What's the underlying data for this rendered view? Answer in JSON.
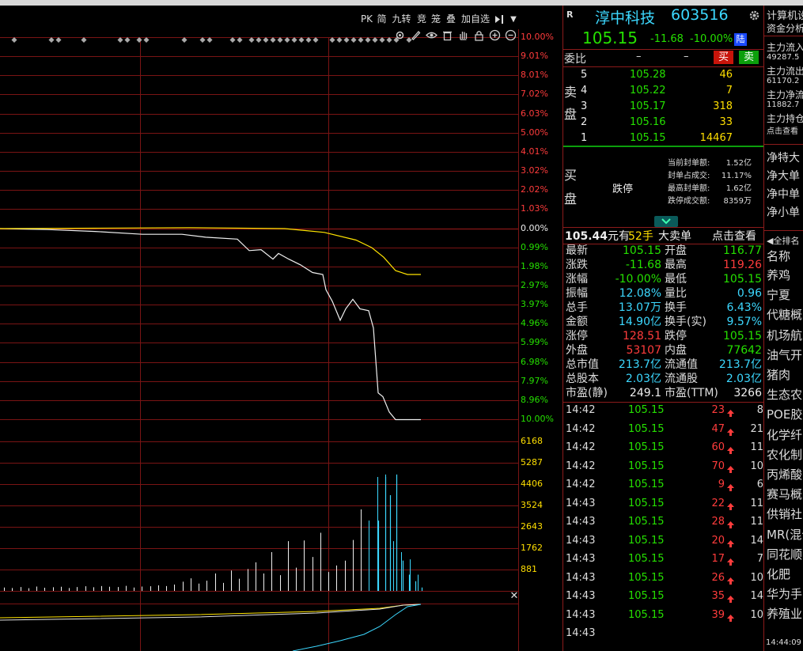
{
  "toolbar": {
    "buttons": [
      "PK",
      "简",
      "九转",
      "竞",
      "笼",
      "叠",
      "加自选"
    ],
    "arrow": "▼"
  },
  "price_axis": {
    "up": [
      "10.00%",
      "9.01%",
      "8.01%",
      "7.02%",
      "6.03%",
      "5.00%",
      "4.01%",
      "3.02%",
      "2.02%",
      "1.03%",
      "0.00%"
    ],
    "down": [
      "0.99%",
      "1.98%",
      "2.97%",
      "3.97%",
      "4.96%",
      "5.99%",
      "6.98%",
      "7.97%",
      "8.96%",
      "10.00%"
    ]
  },
  "volume_axis": [
    "6168",
    "5287",
    "4406",
    "3524",
    "2643",
    "1762",
    "881"
  ],
  "chart_data": {
    "type": "line",
    "price_pct": [
      0,
      -0.1,
      -0.2,
      -0.3,
      -0.4,
      -0.5,
      -0.6,
      -0.7,
      -0.8,
      -0.9,
      -1.0,
      -1.2,
      -1.4,
      -1.3,
      -1.5,
      -1.7,
      -1.9,
      -2.1,
      -2.3,
      -2.5,
      -2.5
    ],
    "avg_pct": [
      0,
      0,
      0,
      0,
      0,
      -0.1,
      -0.2,
      -0.4,
      -0.6,
      -1.0,
      -1.5,
      -2.6,
      -4.0,
      -4.8,
      -3.8,
      -4.4,
      -4.5,
      -6.4,
      -8.6,
      -9.6,
      -10.0,
      -10.0
    ],
    "volume": [
      140,
      120,
      160,
      110,
      180,
      130,
      150,
      170,
      120,
      160,
      190,
      150,
      200,
      170,
      160,
      210,
      140,
      180,
      190,
      230,
      200,
      260,
      380,
      520,
      300,
      420,
      720,
      330,
      840,
      500,
      900,
      1180,
      720,
      1600,
      650,
      2050,
      960,
      2080,
      1400,
      2400,
      780,
      1050,
      1250,
      2100,
      3360,
      2900,
      4700,
      4800,
      2050,
      1600,
      1300,
      670
    ]
  },
  "quote": {
    "logo_letter": "R",
    "name": "淳中科技",
    "code": "603516",
    "price": "105.15",
    "change": "-11.68",
    "change_pct": "-10.00%",
    "tag": "陆",
    "weibi_label": "委比",
    "weibi_val1": "–",
    "weibi_val2": "–",
    "buy_btn": "买",
    "sell_btn": "卖",
    "sell_label": "卖盘",
    "sell_orders": [
      {
        "level": "5",
        "price": "105.28",
        "vol": "46"
      },
      {
        "level": "4",
        "price": "105.22",
        "vol": "7"
      },
      {
        "level": "3",
        "price": "105.17",
        "vol": "318"
      },
      {
        "level": "2",
        "price": "105.16",
        "vol": "33"
      },
      {
        "level": "1",
        "price": "105.15",
        "vol": "14467"
      }
    ],
    "buy_label": "买盘",
    "limit_down": "跌停",
    "seal": [
      {
        "label": "当前封单额:",
        "val": "1.52亿"
      },
      {
        "label": "封单占成交:",
        "val": "11.17%"
      },
      {
        "label": "最高封单额:",
        "val": "1.62亿"
      },
      {
        "label": "跌停成交额:",
        "val": "8359万"
      }
    ],
    "big_order": {
      "price": "105.44",
      "unit": "元有",
      "lots": "52手",
      "label": "大卖单",
      "link": "点击查看"
    },
    "stats": [
      {
        "l1": "最新",
        "v1": "105.15",
        "c1": "green",
        "l2": "开盘",
        "v2": "116.77",
        "c2": "green"
      },
      {
        "l1": "涨跌",
        "v1": "-11.68",
        "c1": "green",
        "l2": "最高",
        "v2": "119.26",
        "c2": "red"
      },
      {
        "l1": "涨幅",
        "v1": "-10.00%",
        "c1": "green",
        "l2": "最低",
        "v2": "105.15",
        "c2": "green"
      },
      {
        "l1": "振幅",
        "v1": "12.08%",
        "c1": "cyan",
        "l2": "量比",
        "v2": "0.96",
        "c2": "cyan"
      },
      {
        "l1": "总手",
        "v1": "13.07万",
        "c1": "cyan",
        "l2": "换手",
        "v2": "6.43%",
        "c2": "cyan"
      },
      {
        "l1": "金额",
        "v1": "14.90亿",
        "c1": "cyan",
        "l2": "换手(实)",
        "v2": "9.57%",
        "c2": "cyan"
      },
      {
        "l1": "涨停",
        "v1": "128.51",
        "c1": "red",
        "l2": "跌停",
        "v2": "105.15",
        "c2": "green"
      },
      {
        "l1": "外盘",
        "v1": "53107",
        "c1": "red",
        "l2": "内盘",
        "v2": "77642",
        "c2": "green"
      },
      {
        "l1": "总市值",
        "v1": "213.7亿",
        "c1": "cyan",
        "l2": "流通值",
        "v2": "213.7亿",
        "c2": "cyan"
      },
      {
        "l1": "总股本",
        "v1": "2.03亿",
        "c1": "cyan",
        "l2": "流通股",
        "v2": "2.03亿",
        "c2": "cyan"
      },
      {
        "l1": "市盈(静)",
        "v1": "249.1",
        "c1": "white",
        "l2": "市盈(TTM)",
        "v2": "3266",
        "c2": "white"
      }
    ],
    "ticks": [
      {
        "time": "14:42",
        "price": "105.15",
        "vol": "23",
        "n": "8"
      },
      {
        "time": "14:42",
        "price": "105.15",
        "vol": "47",
        "n": "21"
      },
      {
        "time": "14:42",
        "price": "105.15",
        "vol": "60",
        "n": "11"
      },
      {
        "time": "14:42",
        "price": "105.15",
        "vol": "70",
        "n": "10"
      },
      {
        "time": "14:42",
        "price": "105.15",
        "vol": "9",
        "n": "6"
      },
      {
        "time": "14:43",
        "price": "105.15",
        "vol": "22",
        "n": "11"
      },
      {
        "time": "14:43",
        "price": "105.15",
        "vol": "28",
        "n": "11"
      },
      {
        "time": "14:43",
        "price": "105.15",
        "vol": "20",
        "n": "14"
      },
      {
        "time": "14:43",
        "price": "105.15",
        "vol": "17",
        "n": "7"
      },
      {
        "time": "14:43",
        "price": "105.15",
        "vol": "26",
        "n": "10"
      },
      {
        "time": "14:43",
        "price": "105.15",
        "vol": "35",
        "n": "14"
      },
      {
        "time": "14:43",
        "price": "105.15",
        "vol": "39",
        "n": "10"
      },
      {
        "time": "14:43",
        "price": "",
        "vol": "",
        "n": ""
      }
    ]
  },
  "right_column": {
    "header": [
      "计算机设",
      "资金分析"
    ],
    "flows": [
      {
        "label": "主力流入",
        "val": "49287.5",
        "color": "red"
      },
      {
        "label": "主力流出",
        "val": "61170.2",
        "color": "green"
      },
      {
        "label": "主力净流",
        "val": "11882.7",
        "color": "green"
      },
      {
        "label": "主力持仓",
        "val": "点击查看",
        "color": "cyan"
      }
    ],
    "net": [
      "净特大",
      "净大单",
      "净中单",
      "净小单"
    ],
    "rank_title": "全排名",
    "rank_header": "名称",
    "sectors": [
      "养鸡",
      "宁夏",
      "代糖概",
      "机场航",
      "油气开",
      "猪肉",
      "生态农",
      "POE胶膜",
      "化学纤",
      "农化制",
      "丙烯酸",
      "赛马概",
      "供销社",
      "MR(混合",
      "同花顺",
      "化肥",
      "华为手",
      "养殖业"
    ],
    "clock": "14:44:09"
  }
}
